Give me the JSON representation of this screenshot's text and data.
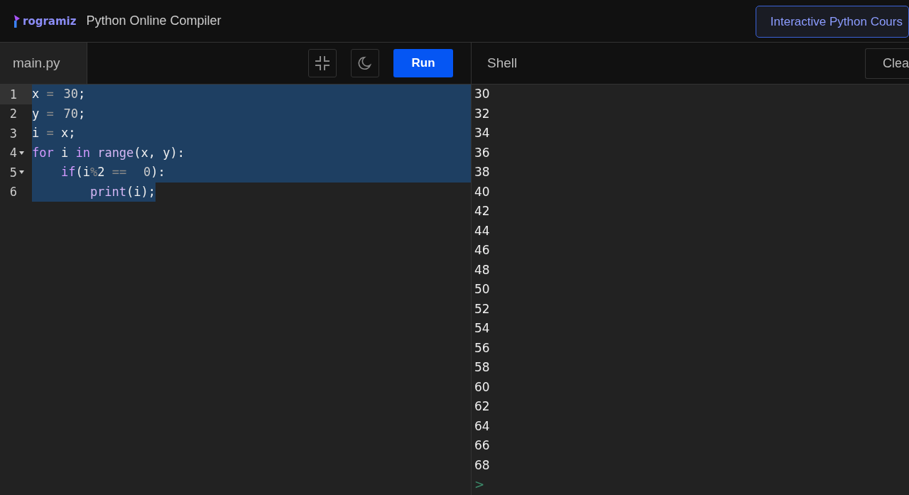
{
  "header": {
    "logo": "rogramiz",
    "title": "Python Online Compiler",
    "course_button": "Interactive Python Cours"
  },
  "editor": {
    "file_tab": {
      "label": "main.py",
      "selected": true
    },
    "run_button": "Run",
    "lines": [
      {
        "number": "1",
        "active": true,
        "foldable": false,
        "selected": true,
        "selection_to_edge": true,
        "tokens": [
          {
            "text": "x ",
            "kind": "plain"
          },
          {
            "text": "= ",
            "kind": "op"
          },
          {
            "text": "30",
            "kind": "num"
          },
          {
            "text": ";",
            "kind": "plain"
          }
        ]
      },
      {
        "number": "2",
        "active": false,
        "foldable": false,
        "selected": true,
        "selection_to_edge": true,
        "tokens": [
          {
            "text": "y ",
            "kind": "plain"
          },
          {
            "text": "= ",
            "kind": "op"
          },
          {
            "text": "70",
            "kind": "num"
          },
          {
            "text": ";",
            "kind": "plain"
          }
        ]
      },
      {
        "number": "3",
        "active": false,
        "foldable": false,
        "selected": true,
        "selection_to_edge": true,
        "tokens": [
          {
            "text": "i ",
            "kind": "plain"
          },
          {
            "text": "= ",
            "kind": "op"
          },
          {
            "text": "x;",
            "kind": "plain"
          }
        ]
      },
      {
        "number": "4",
        "active": false,
        "foldable": true,
        "selected": true,
        "selection_to_edge": true,
        "tokens": [
          {
            "text": "for",
            "kind": "kw"
          },
          {
            "text": " i ",
            "kind": "plain"
          },
          {
            "text": "in ",
            "kind": "kw"
          },
          {
            "text": "range",
            "kind": "fn"
          },
          {
            "text": "(x, y):",
            "kind": "plain"
          }
        ]
      },
      {
        "number": "5",
        "active": false,
        "foldable": true,
        "selected": true,
        "selection_to_edge": true,
        "tokens": [
          {
            "text": "    if",
            "kind": "kw"
          },
          {
            "text": "(i",
            "kind": "plain"
          },
          {
            "text": "%",
            "kind": "op"
          },
          {
            "text": "2 ",
            "kind": "plain"
          },
          {
            "text": "== ",
            "kind": "op"
          },
          {
            "text": "0",
            "kind": "num"
          },
          {
            "text": "):",
            "kind": "plain"
          }
        ]
      },
      {
        "number": "6",
        "active": false,
        "foldable": false,
        "selected": true,
        "selection_to_edge": false,
        "tokens": [
          {
            "text": "        print",
            "kind": "fn"
          },
          {
            "text": "(i);",
            "kind": "plain"
          }
        ]
      }
    ]
  },
  "shell": {
    "title": "Shell",
    "clear_button": "Clea",
    "output": [
      "30",
      "32",
      "34",
      "36",
      "38",
      "40",
      "42",
      "44",
      "46",
      "48",
      "50",
      "52",
      "54",
      "56",
      "58",
      "60",
      "62",
      "64",
      "66",
      "68"
    ],
    "prompt": ">"
  }
}
